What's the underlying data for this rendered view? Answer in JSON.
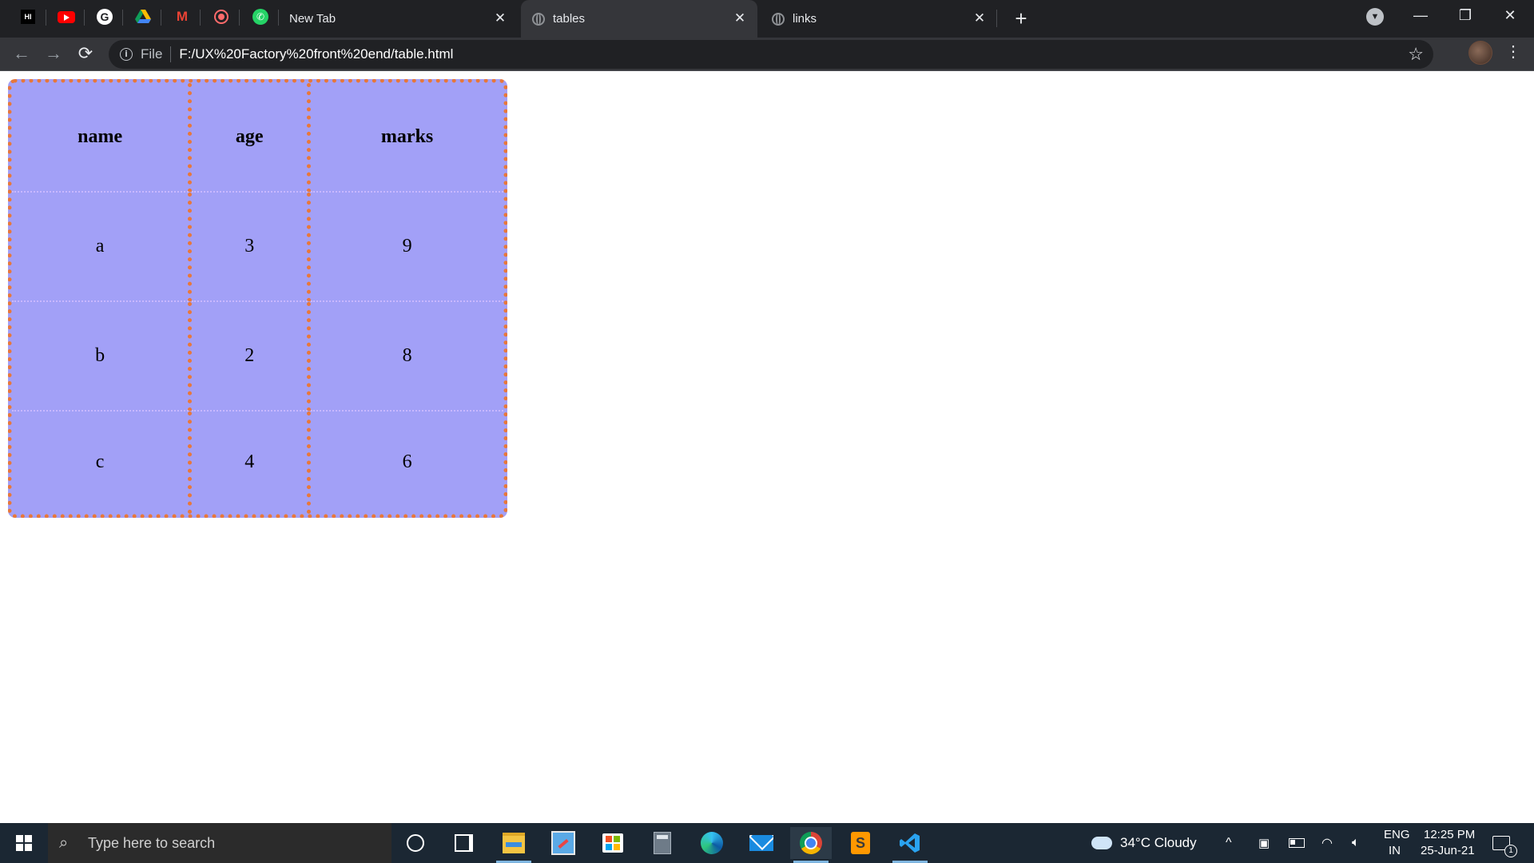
{
  "browser": {
    "pinned_tabs": [
      {
        "icon": "hi-icon",
        "label": "HI"
      },
      {
        "icon": "youtube-icon",
        "label": ""
      },
      {
        "icon": "google-icon",
        "label": "G"
      },
      {
        "icon": "drive-icon",
        "label": ""
      },
      {
        "icon": "gmail-icon",
        "label": "M"
      },
      {
        "icon": "record-icon",
        "label": ""
      },
      {
        "icon": "whatsapp-icon",
        "label": ""
      }
    ],
    "tabs": [
      {
        "title": "New Tab",
        "active": false
      },
      {
        "title": "tables",
        "active": true
      },
      {
        "title": "links",
        "active": false
      }
    ],
    "close_glyph": "✕",
    "new_tab_glyph": "+",
    "omnibox": {
      "scheme_label": "File",
      "url": "F:/UX%20Factory%20front%20end/table.html"
    }
  },
  "table": {
    "headers": [
      "name",
      "age",
      "marks"
    ],
    "rows": [
      [
        "a",
        "3",
        "9"
      ],
      [
        "b",
        "2",
        "8"
      ],
      [
        "c",
        "4",
        "6"
      ]
    ],
    "colors": {
      "background": "#a2a0f7",
      "border": "#e8783a"
    }
  },
  "taskbar": {
    "search_placeholder": "Type here to search",
    "weather": "34°C  Cloudy",
    "lang_top": "ENG",
    "lang_bottom": "IN",
    "time": "12:25 PM",
    "date": "25-Jun-21",
    "notification_count": "1",
    "apps": [
      "cortana-icon",
      "task-view-icon",
      "file-explorer-icon",
      "paint-icon",
      "store-icon",
      "calculator-icon",
      "edge-icon",
      "mail-icon",
      "chrome-icon",
      "sublime-icon",
      "vscode-icon"
    ]
  }
}
